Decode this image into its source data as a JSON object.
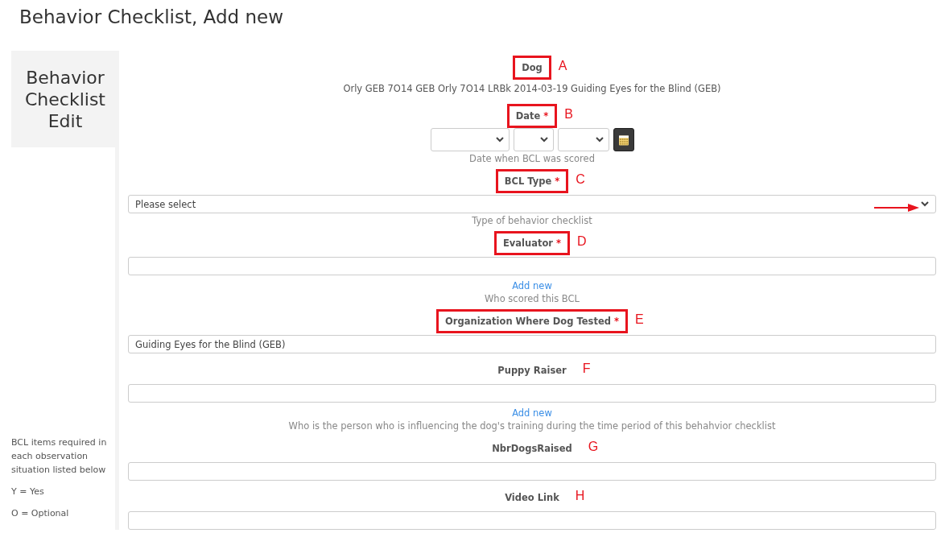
{
  "page_title": "Behavior Checklist, Add new",
  "sidebar": {
    "title": "Behavior Checklist Edit",
    "notes": [
      "BCL items required in each observation situation listed below",
      "Y = Yes",
      "O = Optional"
    ]
  },
  "fields": [
    {
      "kind": "display",
      "label": "Dog",
      "value": "Orly GEB 7O14 GEB Orly 7O14 LRBk 2014-03-19 Guiding Eyes for the Blind (GEB)",
      "annotation": "A",
      "highlighted": true
    },
    {
      "kind": "date",
      "label": "Date",
      "required_mark": "*",
      "hint": "Date when BCL was scored",
      "annotation": "B",
      "highlighted": true
    },
    {
      "kind": "select",
      "label": "BCL Type",
      "required_mark": "*",
      "placeholder": "Please select",
      "hint": "Type of behavior checklist",
      "annotation": "C",
      "highlighted": true,
      "pointer_arrow": true
    },
    {
      "kind": "text",
      "label": "Evaluator",
      "required_mark": "*",
      "link": "Add new",
      "hint": "Who scored this BCL",
      "annotation": "D",
      "highlighted": true
    },
    {
      "kind": "text",
      "label": "Organization Where Dog Tested",
      "required_mark": "*",
      "value": "Guiding Eyes for the Blind (GEB)",
      "annotation": "E",
      "highlighted": true
    },
    {
      "kind": "text",
      "label": "Puppy Raiser",
      "link": "Add new",
      "hint": "Who is the person who is influencing the dog's training during the time period of this behahvior checklist",
      "annotation": "F",
      "highlighted": false
    },
    {
      "kind": "text",
      "label": "NbrDogsRaised",
      "annotation": "G",
      "highlighted": false
    },
    {
      "kind": "text",
      "label": "Video Link",
      "annotation": "H",
      "highlighted": false
    }
  ]
}
